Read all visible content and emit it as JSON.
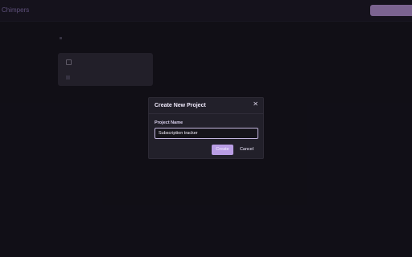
{
  "header": {
    "brand": "Chimpers",
    "action_label": ""
  },
  "background": {
    "section_label": "",
    "project_card_title": ""
  },
  "dialog": {
    "title": "Create New Project",
    "close_glyph": "✕",
    "field_label": "Project Name",
    "input_value": "Subscription tracker",
    "create_label": "Create",
    "cancel_label": "Cancel"
  },
  "colors": {
    "background": "#16141d",
    "dialog": "#22202a",
    "accent": "#b99de4",
    "text": "#f0ebff"
  }
}
